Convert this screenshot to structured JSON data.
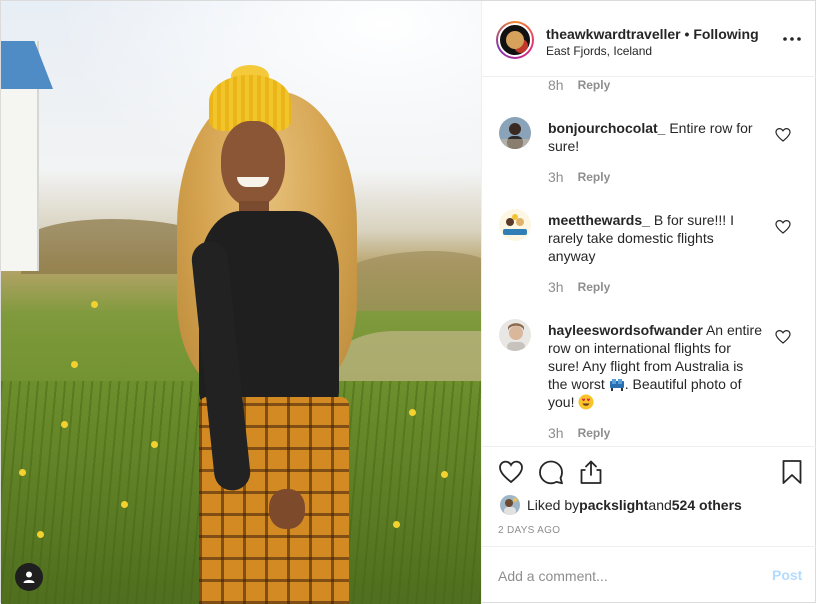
{
  "post": {
    "header": {
      "username": "theawkwardtraveller",
      "separator": "•",
      "follow_status": "Following",
      "location": "East Fjords, Iceland",
      "avatar_icon": "profile-avatar",
      "more_icon": "more-options-icon"
    },
    "photo": {
      "user_tag_icon": "user-tag-icon"
    },
    "previous_comment_meta": {
      "time": "8h",
      "reply": "Reply"
    },
    "comments": [
      {
        "username": "bonjourchocolat_",
        "text": " Entire row for sure!",
        "time": "3h",
        "reply": "Reply"
      },
      {
        "username": "meetthewards_",
        "text": " B for sure!!! I rarely take domestic flights anyway",
        "time": "3h",
        "reply": "Reply"
      },
      {
        "username": "hayleeswordsofwander",
        "text_before": " An entire row on international flights for sure! Any flight from Australia is the worst ",
        "text_middle": ". Beautiful photo of you! ",
        "time": "3h",
        "reply": "Reply"
      }
    ],
    "actions": {
      "like_icon": "heart-icon",
      "comment_icon": "comment-icon",
      "share_icon": "share-icon",
      "save_icon": "bookmark-icon"
    },
    "likes": {
      "prefix": "Liked by ",
      "user": "packslight",
      "middle": " and ",
      "count": "524 others"
    },
    "date": "2 DAYS AGO",
    "add_comment": {
      "placeholder": "Add a comment...",
      "post_label": "Post"
    },
    "colors": {
      "text": "#262626",
      "muted": "#8e8e8e",
      "post_disabled": "#b3dbff",
      "divider": "#efefef"
    }
  }
}
